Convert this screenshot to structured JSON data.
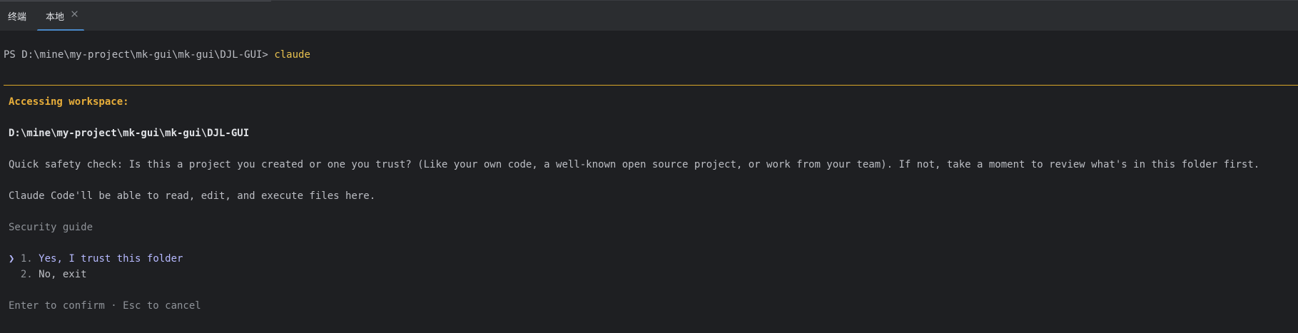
{
  "tabs": {
    "main_label": "终端",
    "local_label": "本地"
  },
  "terminal": {
    "prompt_path": "PS D:\\mine\\my-project\\mk-gui\\mk-gui\\DJL-GUI>",
    "command": "claude",
    "heading": "Accessing workspace:",
    "workspace_path": "D:\\mine\\my-project\\mk-gui\\mk-gui\\DJL-GUI",
    "safety_text": "Quick safety check: Is this a project you created or one you trust? (Like your own code, a well-known open source project, or work from your team). If not, take a moment to review what's in this folder first.",
    "capability_text": "Claude Code'll be able to read, edit, and execute files here.",
    "security_guide": "Security guide",
    "options": [
      {
        "pointer": "❯",
        "number": "1.",
        "label": "Yes, I trust this folder"
      },
      {
        "pointer": "",
        "number": "2.",
        "label": "No, exit"
      }
    ],
    "hint": "Enter to confirm · Esc to cancel"
  },
  "colors": {
    "accent_yellow": "#e8c14f",
    "divider_orange": "#d9a628",
    "selection_purple": "#b6b9ff",
    "tab_underline_blue": "#4a88c7"
  }
}
